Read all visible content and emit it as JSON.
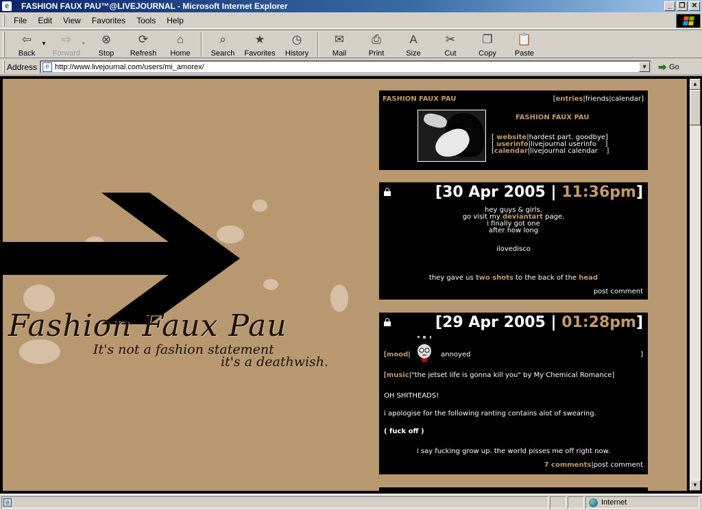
{
  "window": {
    "title": "FASHION FAUX PAU™@LIVEJOURNAL - Microsoft Internet Explorer",
    "minimize": "_",
    "maximize": "❐",
    "close": "✕"
  },
  "menu": {
    "items": [
      "File",
      "Edit",
      "View",
      "Favorites",
      "Tools",
      "Help"
    ]
  },
  "toolbar": {
    "back": "Back",
    "forward": "Forward",
    "stop": "Stop",
    "refresh": "Refresh",
    "home": "Home",
    "search": "Search",
    "favorites": "Favorites",
    "history": "History",
    "mail": "Mail",
    "print": "Print",
    "size": "Size",
    "cut": "Cut",
    "copy": "Copy",
    "paste": "Paste"
  },
  "address": {
    "label": "Address",
    "url": "http://www.livejournal.com/users/mi_amorex/",
    "go": "Go"
  },
  "banner": {
    "title": "Fashion Faux Pau",
    "tagline1": "It's not a fashion statement",
    "tagline2": "it's a deathwish."
  },
  "header": {
    "journal_name": "FASHION FAUX PAU",
    "nav_entries": "entries",
    "nav_friends": "friends",
    "nav_calendar": "calendar",
    "title": "FASHION FAUX PAU",
    "link1_label": "website",
    "link1_desc": "hardest part. goodbye",
    "link2_label": "userinfo",
    "link2_desc": "livejournal userinfo",
    "link3_label": "calendar",
    "link3_desc": "livejournal calendar"
  },
  "entry1": {
    "date": "30 Apr 2005",
    "time": "11:36pm",
    "line1": "hey guys & girls.",
    "line2a": "go visit my ",
    "line2link": "deviantart",
    "line2b": " page.",
    "line3": "i finally got one",
    "line4": "after how long",
    "line5": "ilovedisco",
    "line6a": "they gave us ",
    "line6b": "two shots",
    "line6c": " to the back of the ",
    "line6d": "head",
    "post_comment": "post comment"
  },
  "entry2": {
    "date": "29 Apr 2005",
    "time": "01:28pm",
    "mood_label": "mood",
    "mood_value": "annoyed",
    "mood_icon": "annoyed-face-icon",
    "music_label": "music",
    "music_value": "\"the jetset life is gonna kill you\" by My Chemical Romance",
    "p1": "OH SHITHEADS!",
    "p2": "i apologise for the following ranting contains alot of swearing.",
    "p3": "( fuck off )",
    "p4": "i say fucking grow up. the world pisses me off right now.",
    "comments": "7 comments",
    "post_comment": "post comment"
  },
  "status": {
    "zone": "Internet"
  },
  "colors": {
    "page_bg": "#b89871",
    "accent": "#c49a6c",
    "splat": "#d6bfa5"
  }
}
